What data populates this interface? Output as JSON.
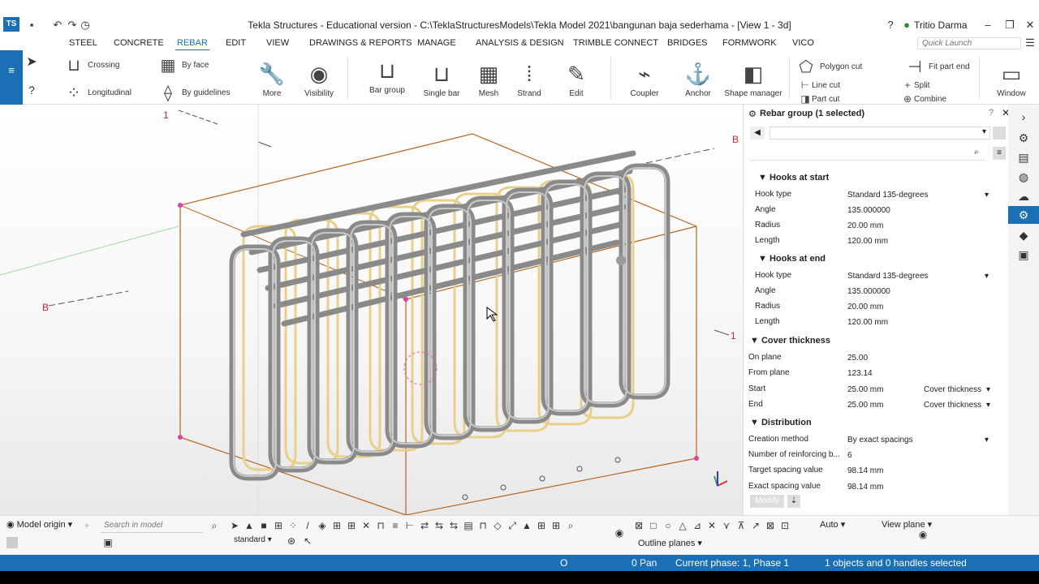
{
  "window": {
    "title": "Tekla Structures - Educational version - C:\\TeklaStructuresModels\\Tekla Model 2021\\bangunan baja sederhama - [View 1 - 3d]",
    "user": "Tritio Darma",
    "logo": "TS"
  },
  "menu": {
    "items": [
      "STEEL",
      "CONCRETE",
      "REBAR",
      "EDIT",
      "VIEW",
      "DRAWINGS & REPORTS",
      "MANAGE",
      "ANALYSIS & DESIGN",
      "TRIMBLE CONNECT",
      "BRIDGES",
      "FORMWORK",
      "VICO"
    ],
    "active": "REBAR",
    "quick_launch_placeholder": "Quick Launch"
  },
  "ribbon": {
    "crossing": "Crossing",
    "longitudinal": "Longitudinal",
    "by_face": "By face",
    "by_guidelines": "By guidelines",
    "more": "More",
    "visibility": "Visibility",
    "bar_group": "Bar group",
    "single_bar": "Single bar",
    "mesh": "Mesh",
    "strand": "Strand",
    "edit": "Edit",
    "coupler": "Coupler",
    "anchor": "Anchor",
    "shape_manager": "Shape manager",
    "polygon_cut": "Polygon cut",
    "line_cut": "Line cut",
    "part_cut": "Part cut",
    "fit_part_end": "Fit part end",
    "split": "Split",
    "combine": "Combine",
    "window": "Window"
  },
  "viewport": {
    "grid_labels": {
      "top_1": "1",
      "right_b": "B",
      "left_b": "B",
      "right_1": "1"
    }
  },
  "panel": {
    "title": "Rebar group (1 selected)",
    "hooks_start": {
      "heading": "Hooks at start",
      "hook_type_label": "Hook type",
      "hook_type": "Standard 135-degrees",
      "angle_label": "Angle",
      "angle": "135.000000",
      "radius_label": "Radius",
      "radius": "20.00 mm",
      "length_label": "Length",
      "length": "120.00 mm"
    },
    "hooks_end": {
      "heading": "Hooks at end",
      "hook_type_label": "Hook type",
      "hook_type": "Standard 135-degrees",
      "angle_label": "Angle",
      "angle": "135.000000",
      "radius_label": "Radius",
      "radius": "20.00 mm",
      "length_label": "Length",
      "length": "120.00 mm"
    },
    "cover": {
      "heading": "Cover thickness",
      "on_plane_label": "On plane",
      "on_plane": "25.00",
      "from_plane_label": "From plane",
      "from_plane": "123.14",
      "start_label": "Start",
      "start": "25.00 mm",
      "start_mode": "Cover thickness",
      "end_label": "End",
      "end": "25.00 mm",
      "end_mode": "Cover thickness"
    },
    "distribution": {
      "heading": "Distribution",
      "creation_label": "Creation method",
      "creation": "By exact spacings",
      "number_label": "Number of reinforcing b...",
      "number": "6",
      "target_label": "Target spacing value",
      "target": "98.14 mm",
      "exact_label": "Exact spacing value",
      "exact": "98.14 mm"
    },
    "modify": "Modify"
  },
  "bottom": {
    "model_origin": "Model origin",
    "search_placeholder": "Search in model",
    "standard": "standard",
    "auto": "Auto",
    "view_plane": "View plane",
    "outline_planes": "Outline planes"
  },
  "status": {
    "o": "O",
    "pan": "0  Pan",
    "phase": "Current phase: 1, Phase 1",
    "selection": "1 objects and 0 handles selected"
  },
  "colors": {
    "accent": "#1b6fb5",
    "rebar_gray": "#8a8a8a",
    "rebar_yellow": "#e8d08a",
    "frame": "#b5651d"
  }
}
